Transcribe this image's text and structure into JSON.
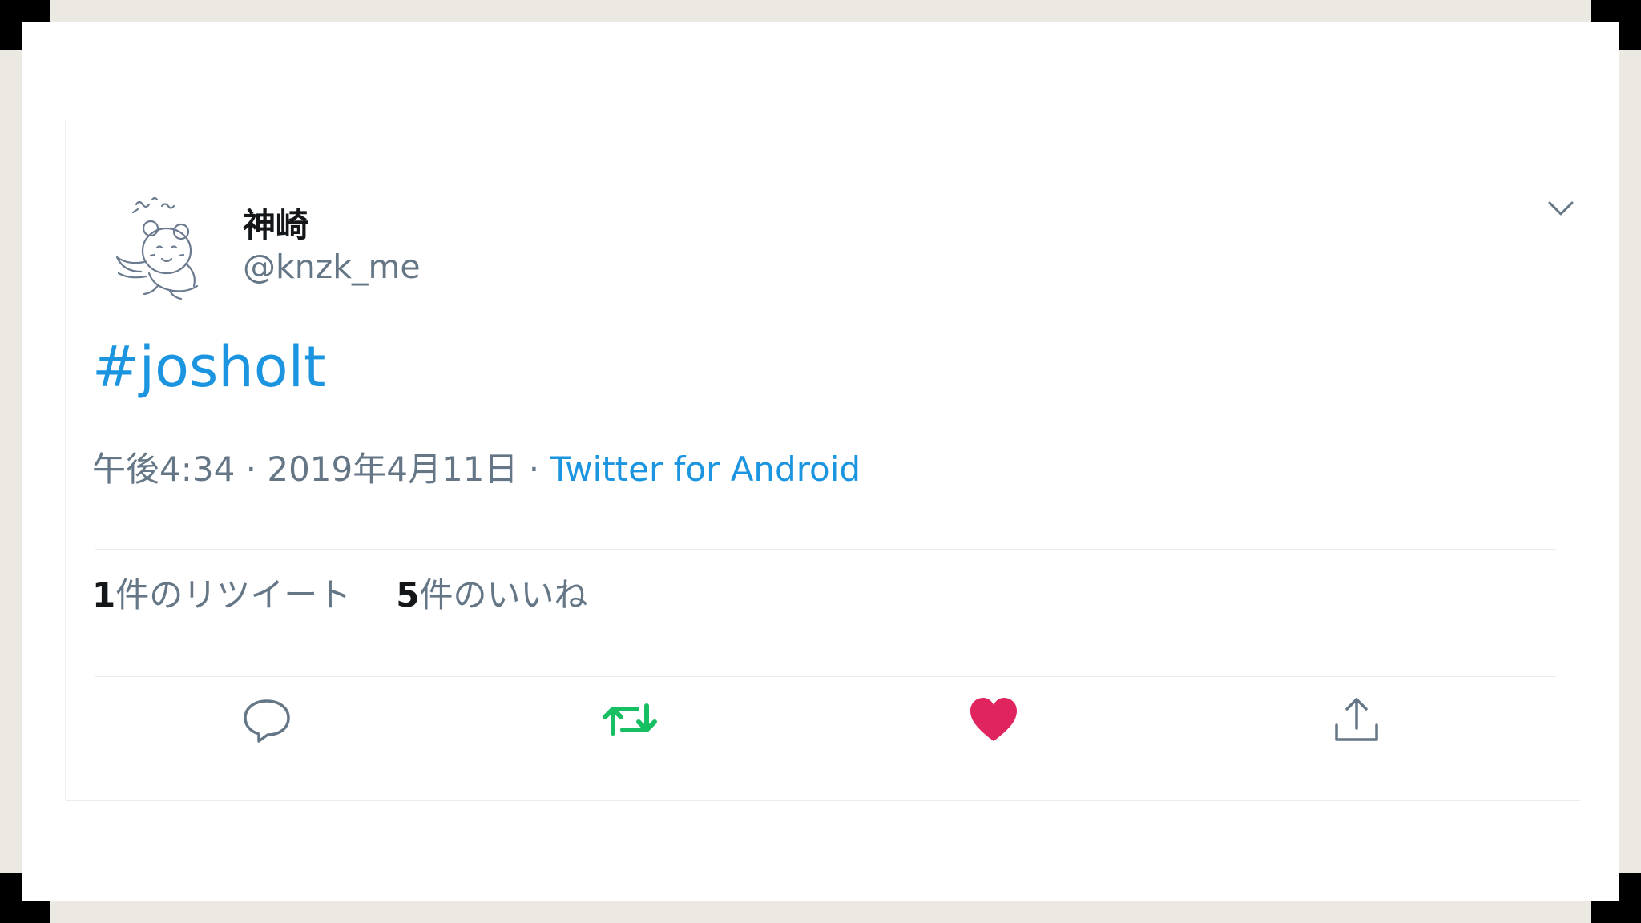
{
  "tweet": {
    "display_name": "神崎",
    "handle": "@knzk_me",
    "text": "#josholt",
    "timestamp": "午後4:34 · 2019年4月11日",
    "separator": " · ",
    "source": "Twitter for Android",
    "retweet_count": "1",
    "retweet_label": "件のリツイート",
    "like_count": "5",
    "like_label": "件のいいね"
  },
  "icons": {
    "avatar": "bear-sketch-avatar",
    "caret": "chevron-down-icon",
    "reply": "reply-icon",
    "retweet": "retweet-icon",
    "like": "heart-icon",
    "share": "share-icon"
  },
  "colors": {
    "link": "#1b95e0",
    "retweet_active": "#17bf63",
    "like_active": "#e0245e",
    "secondary_text": "#657786",
    "primary_text": "#14171a"
  }
}
